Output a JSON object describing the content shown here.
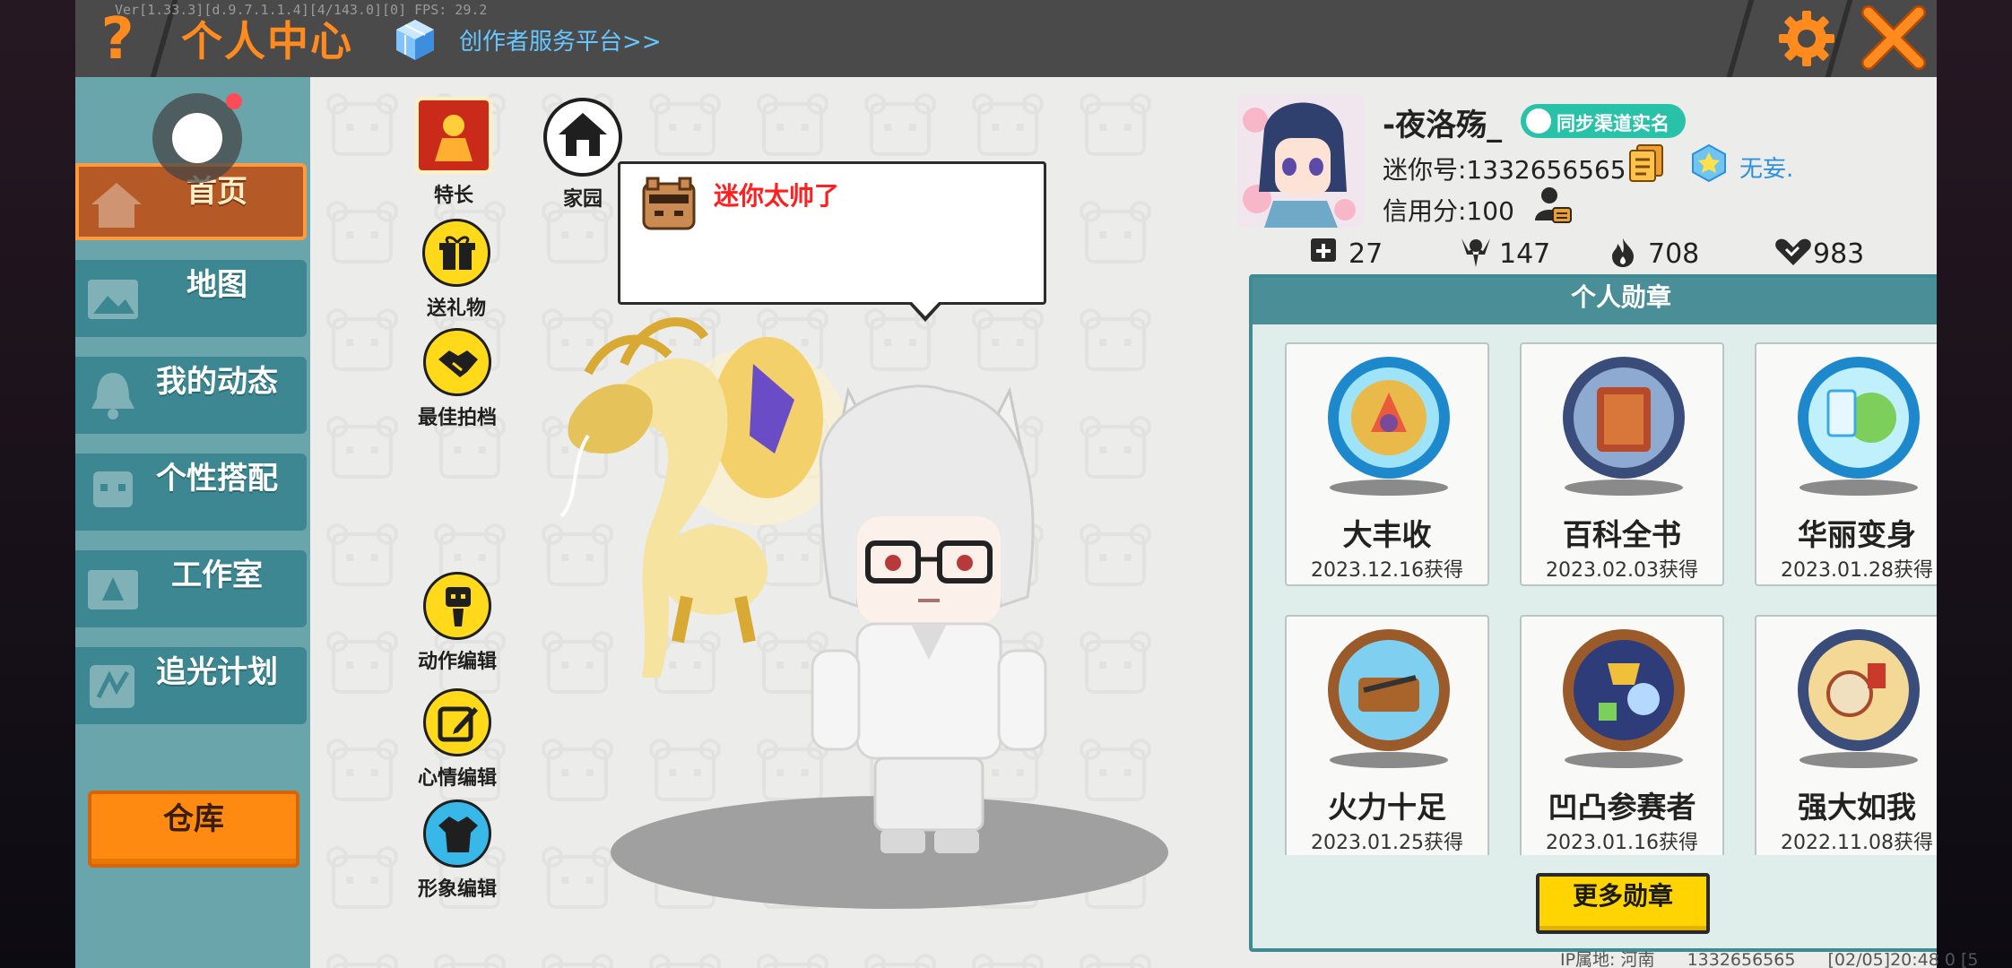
{
  "header": {
    "debug": "Ver[1.33.3][d.9.7.1.1.4][4/143.0][0] FPS: 29.2",
    "title": "个人中心",
    "creator_link": "创作者服务平台>>"
  },
  "sidebar": {
    "items": [
      {
        "label": "首页",
        "active": true
      },
      {
        "label": "地图",
        "active": false
      },
      {
        "label": "我的动态",
        "active": false
      },
      {
        "label": "个性搭配",
        "active": false
      },
      {
        "label": "工作室",
        "active": false
      },
      {
        "label": "追光计划",
        "active": false
      }
    ],
    "warehouse": "仓库"
  },
  "actions": {
    "specialty": "特长",
    "home": "家园",
    "gift": "送礼物",
    "best_shot": "最佳拍档",
    "action_edit": "动作编辑",
    "mood_edit": "心情编辑",
    "image_edit": "形象编辑"
  },
  "bubble": {
    "text": "迷你太帅了"
  },
  "profile": {
    "nickname": "-夜洛殇_",
    "sync_badge": "同步渠道实名",
    "mini_id": "迷你号:1332656565",
    "title": "无妄.",
    "credit": "信用分:100",
    "stats": [
      {
        "icon": "add-friend-icon",
        "value": "27"
      },
      {
        "icon": "fans-icon",
        "value": "147"
      },
      {
        "icon": "fire-icon",
        "value": "708"
      },
      {
        "icon": "heart-icon",
        "value": "983"
      }
    ]
  },
  "medals": {
    "title": "个人勋章",
    "items": [
      {
        "name": "大丰收",
        "date": "2023.12.16获得",
        "color": "#3aa9e6"
      },
      {
        "name": "百科全书",
        "date": "2023.02.03获得",
        "color": "#5a6f9e"
      },
      {
        "name": "华丽变身",
        "date": "2023.01.28获得",
        "color": "#3aa9e6"
      },
      {
        "name": "火力十足",
        "date": "2023.01.25获得",
        "color": "#c9783a"
      },
      {
        "name": "凹凸参赛者",
        "date": "2023.01.16获得",
        "color": "#c9783a"
      },
      {
        "name": "强大如我",
        "date": "2022.11.08获得",
        "color": "#5a6f9e"
      }
    ],
    "more": "更多勋章"
  },
  "footer": {
    "ip": "IP属地: 河南",
    "id": "1332656565",
    "time": "[02/05]20:48 0 [5"
  },
  "colors": {
    "accent_orange": "#ff8a1e",
    "sidebar_teal": "#3c8791",
    "active_tab": "#b55a26",
    "button_yellow": "#ffd400"
  }
}
